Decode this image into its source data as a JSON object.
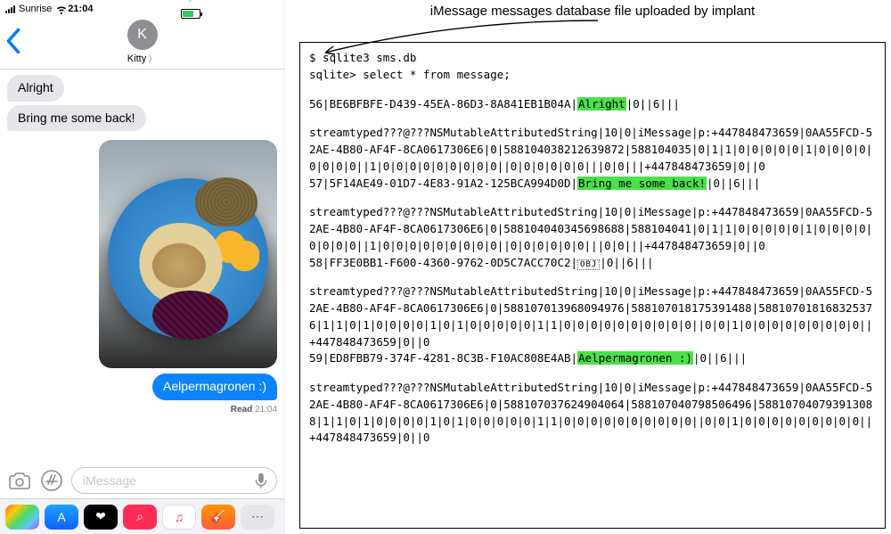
{
  "status_bar": {
    "carrier": "Sunrise",
    "time": "21:04",
    "battery_color": "#34c759"
  },
  "conversation": {
    "contact_initial": "K",
    "contact_name": "Kitty",
    "messages": {
      "in1": "Alright",
      "in2": "Bring me some back!",
      "out1": "Aelpermagronen :)"
    },
    "read_receipt": {
      "label": "Read",
      "time": "21:04"
    }
  },
  "composer": {
    "placeholder": "iMessage"
  },
  "app_drawer": {
    "icons": [
      {
        "name": "photos-app-icon",
        "bg": "linear-gradient(135deg,#ff5e3a,#ffcc00,#4cd964,#5ac8fa,#af52de)"
      },
      {
        "name": "appstore-app-icon",
        "bg": "linear-gradient(180deg,#1fa2ff,#0a60ff)",
        "glyph": "A"
      },
      {
        "name": "heart-app-icon",
        "bg": "#000",
        "glyph": "❤"
      },
      {
        "name": "search-app-icon",
        "bg": "#ff2d55",
        "glyph": "⌕"
      },
      {
        "name": "music-app-icon",
        "bg": "#fff",
        "glyph": "♫",
        "fg": "#ff2d55",
        "border": "1px solid #ddd"
      },
      {
        "name": "garageband-app-icon",
        "bg": "linear-gradient(180deg,#ff9500,#ff5e3a)",
        "glyph": "🎸"
      },
      {
        "name": "more-apps-icon",
        "bg": "#e5e5ea",
        "glyph": "⋯",
        "fg": "#555"
      }
    ]
  },
  "annotation": {
    "caption": "iMessage messages database file uploaded by implant"
  },
  "terminal": {
    "prompt": "$ sqlite3 sms.db",
    "query": "sqlite> select * from message;",
    "rows": [
      {
        "pre": "56|BE6BFBFE-D439-45EA-86D3-8A841EB1B04A|",
        "hl": "Alright",
        "post": "|0||6|||"
      },
      {
        "pre": "57|5F14AE49-01D7-4E83-91A2-125BCA994D0D|",
        "hl": "Bring me some back!",
        "post": "|0||6|||"
      },
      {
        "pre": "58|FF3E0BB1-F600-4360-9762-0D5C7ACC70C2|",
        "obj": "OBJ",
        "post": "|0||6|||"
      },
      {
        "pre": "59|ED8FBB79-374F-4281-8C3B-F10AC808E4AB|",
        "hl": "Aelpermagronen :)",
        "post": "|0||6|||"
      }
    ],
    "blobs": [
      "streamtyped???@???NSMutableAttributedString|10|0|iMessage|p:+447848473659|0AA55FCD-52AE-4B80-AF4F-8CA0617306E6|0|588104038212639872|588104035|0|1|1|0|0|0|0|0|1|0|0|0|0|0|0|0|0||1|0|0|0|0|0|0|0|0|0||0|0|0|0|0|0|||0|0|||+447848473659|0||0",
      "streamtyped???@???NSMutableAttributedString|10|0|iMessage|p:+447848473659|0AA55FCD-52AE-4B80-AF4F-8CA0617306E6|0|588104040345698688|588104041|0|1|1|0|0|0|0|0|1|0|0|0|0|0|0|0|0||1|0|0|0|0|0|0|0|0|0||0|0|0|0|0|0|||0|0|||+447848473659|0||0",
      "streamtyped???@???NSMutableAttributedString|10|0|iMessage|p:+447848473659|0AA55FCD-52AE-4B80-AF4F-8CA0617306E6|0|588107013968094976|588107018175391488|588107018168325376|1|1|0|1|0|0|0|0|1|0|1|0|0|0|0|0|1|1|0|0|0|0|0|0|0|0|0|0||0|0|1|0|0|0|0|0|0|0|0|0||+447848473659|0||0",
      "streamtyped???@???NSMutableAttributedString|10|0|iMessage|p:+447848473659|0AA55FCD-52AE-4B80-AF4F-8CA0617306E6|0|588107037624904064|588107040798506496|588107040793913088|1|1|0|1|0|0|0|0|1|0|1|0|0|0|0|0|1|1|0|0|0|0|0|0|0|0|0|0||0|0|1|0|0|0|0|0|0|0|0|0||+447848473659|0||0"
    ]
  }
}
